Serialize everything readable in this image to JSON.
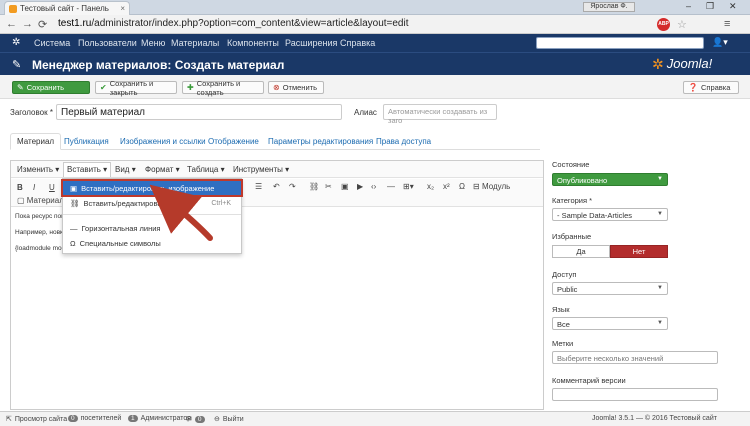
{
  "browser": {
    "tab_title": "Тестовый сайт - Панель",
    "tab_close": "×",
    "user_label": "Ярослав Ф.",
    "window_controls": [
      "–",
      "❐",
      "✕"
    ],
    "url_host": "test1.ru",
    "url_path": "/administrator/index.php?option=com_content&view=article&layout=edit",
    "abp": "ABP"
  },
  "admin_nav": {
    "items": [
      "Система",
      "Пользователи",
      "Меню",
      "Материалы",
      "Компоненты",
      "Расширения",
      "Справка"
    ],
    "user_icon": "▾"
  },
  "page": {
    "title": "Менеджер материалов: Создать материал",
    "logo_text": "Joomla!"
  },
  "toolbar": {
    "save": "Сохранить",
    "save_close": "Сохранить и закрыть",
    "save_new": "Сохранить и создать",
    "cancel": "Отменить",
    "help": "Справка"
  },
  "form": {
    "title_label": "Заголовок *",
    "title_value": "Первый материал",
    "alias_label": "Алиас",
    "alias_placeholder": "Автоматически создавать из заго"
  },
  "tabs": [
    "Материал",
    "Публикация",
    "Изображения и ссылки",
    "Отображение",
    "Параметры редактирования",
    "Права доступа"
  ],
  "editor": {
    "menus": [
      "Изменить ▾",
      "Вставить ▾",
      "Вид ▾",
      "Формат ▾",
      "Таблица ▾",
      "Инструменты ▾"
    ],
    "tools_row1": [
      "B",
      "I",
      "U"
    ],
    "tools_row2_left": "Материал",
    "module_btn": "Модуль",
    "content": [
      "Пока ресурс пои",
      "Например, новк",
      "{loadmodule moc"
    ]
  },
  "insert_menu": {
    "items": [
      {
        "label": "Вставить/редактировать изображение",
        "shortcut": ""
      },
      {
        "label": "Вставить/редактировать ссылку",
        "shortcut": "Ctrl+K"
      },
      {
        "label": "Горизонтальная линия",
        "shortcut": ""
      },
      {
        "label": "Специальные символы",
        "shortcut": ""
      }
    ]
  },
  "sidebar": {
    "status_label": "Состояние",
    "status_value": "Опубликовано",
    "category_label": "Категория *",
    "category_value": "- Sample Data-Articles",
    "featured_label": "Избранные",
    "featured_yes": "Да",
    "featured_no": "Нет",
    "access_label": "Доступ",
    "access_value": "Public",
    "language_label": "Язык",
    "language_value": "Все",
    "tags_label": "Метки",
    "tags_placeholder": "Выберите несколько значений",
    "version_label": "Комментарий версии"
  },
  "statusbar": {
    "view_site": "Просмотр сайта",
    "visitors_count": "0",
    "visitors_label": "посетителей",
    "admins_count": "1",
    "admins_label": "Администратор",
    "messages_count": "0",
    "logout": "Выйти",
    "copyright": "Joomla! 3.5.1 — © 2016 Тестовый сайт"
  },
  "colors": {
    "nav_bg": "#1a3867",
    "primary_green": "#3f9a3f",
    "danger_red": "#b32d2d",
    "highlight_blue": "#2f6fc2"
  }
}
